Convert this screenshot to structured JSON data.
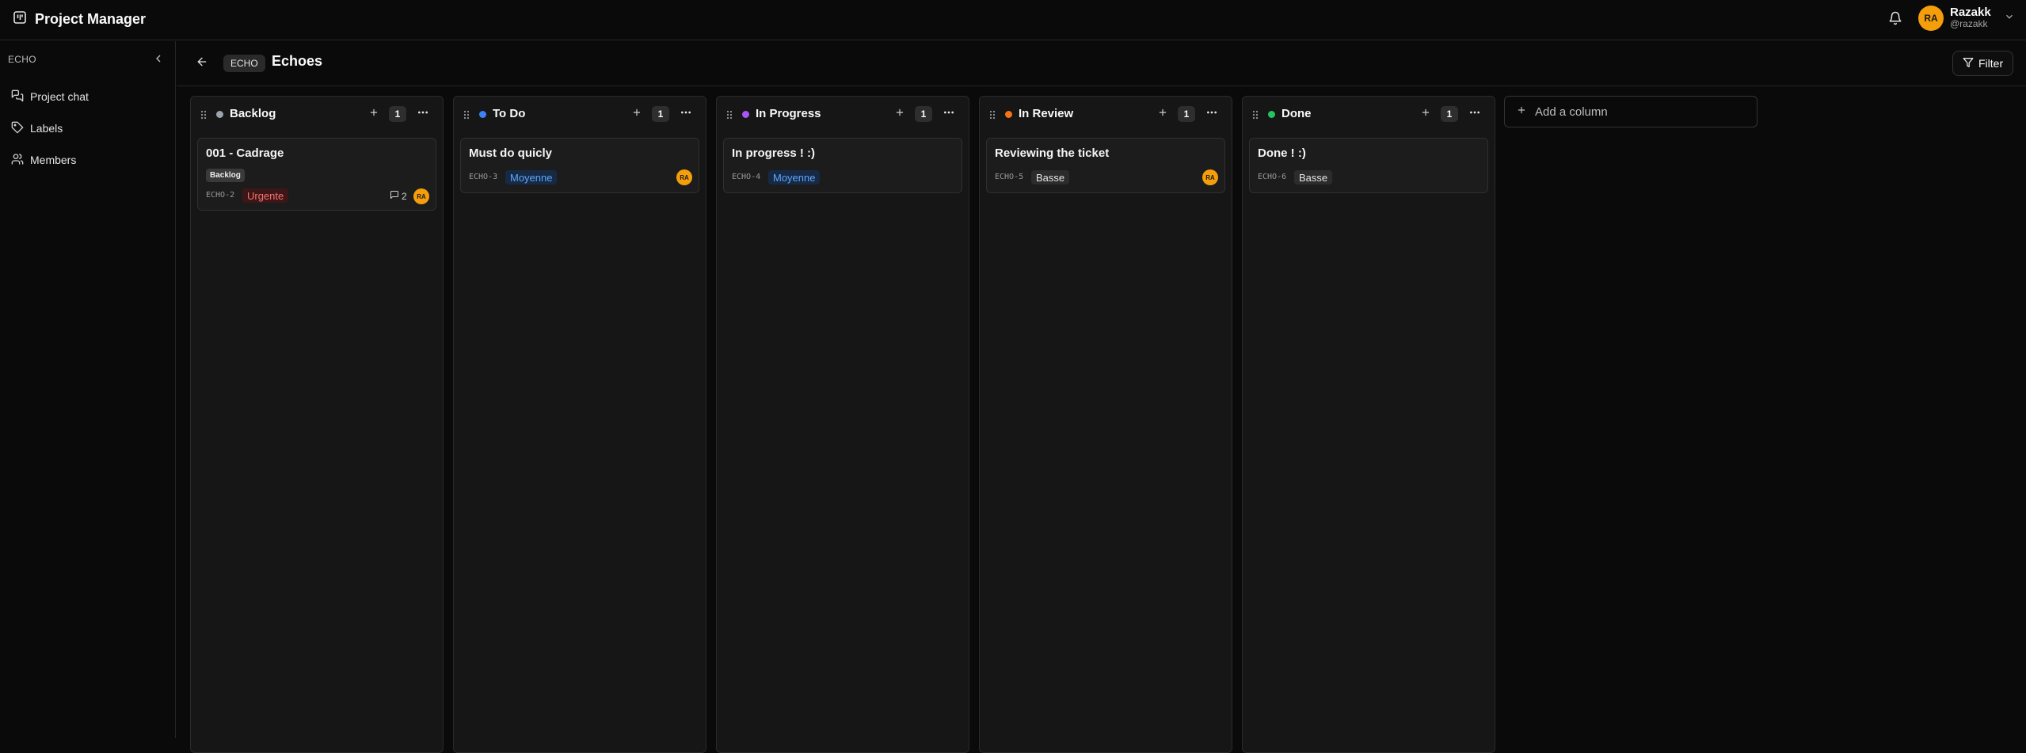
{
  "app": {
    "title": "Project Manager"
  },
  "user": {
    "name": "Razakk",
    "handle": "@razakk",
    "initials": "RA"
  },
  "sidebar": {
    "project_key": "ECHO",
    "items": [
      {
        "label": "Project chat",
        "icon": "chat-icon"
      },
      {
        "label": "Labels",
        "icon": "tag-icon"
      },
      {
        "label": "Members",
        "icon": "users-icon"
      }
    ]
  },
  "header": {
    "badge": "ECHO",
    "project_name": "Echoes",
    "filter_label": "Filter"
  },
  "board": {
    "add_column_label": "Add a column",
    "columns": [
      {
        "title": "Backlog",
        "count": "1",
        "color": "#9ca3af",
        "card": {
          "title": "001 - Cadrage",
          "label": "Backlog",
          "id": "ECHO-2",
          "priority": "Urgente",
          "comments": "2",
          "assignee": "RA"
        }
      },
      {
        "title": "To Do",
        "count": "1",
        "color": "#3b82f6",
        "card": {
          "title": "Must do quicly",
          "id": "ECHO-3",
          "priority": "Moyenne",
          "assignee": "RA"
        }
      },
      {
        "title": "In Progress",
        "count": "1",
        "color": "#a855f7",
        "card": {
          "title": "In progress ! :)",
          "id": "ECHO-4",
          "priority": "Moyenne"
        }
      },
      {
        "title": "In Review",
        "count": "1",
        "color": "#f97316",
        "card": {
          "title": "Reviewing the ticket",
          "id": "ECHO-5",
          "priority": "Basse",
          "assignee": "RA"
        }
      },
      {
        "title": "Done",
        "count": "1",
        "color": "#22c55e",
        "card": {
          "title": "Done ! :)",
          "id": "ECHO-6",
          "priority": "Basse"
        }
      }
    ]
  }
}
